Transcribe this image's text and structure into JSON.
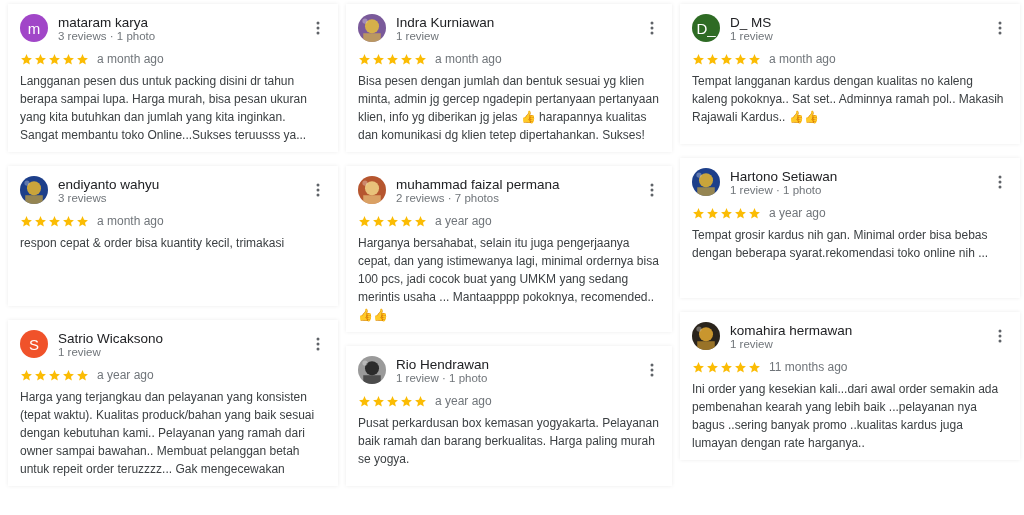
{
  "columns": [
    {
      "reviews": [
        {
          "avatar": {
            "kind": "letter",
            "letter": "m",
            "color": "#a146c8"
          },
          "name": "mataram karya",
          "meta": "3 reviews · 1 photo",
          "stars": 5,
          "time": "a month ago",
          "text": "Langganan pesen dus untuk packing disini dr tahun berapa sampai lupa. Harga murah, bisa pesan ukuran yang kita butuhkan dan jumlah yang kita inginkan. Sangat membantu toko Online...Sukses teruusss ya..."
        },
        {
          "name": "endiyanto wahyu",
          "meta": "3 reviews",
          "stars": 5,
          "time": "a month ago",
          "text": "respon cepat & order bisa kuantity kecil, trimakasi"
        },
        {
          "avatar": {
            "kind": "letter",
            "letter": "S",
            "color": "#f0522a"
          },
          "name": "Satrio Wicaksono",
          "meta": "1 review",
          "stars": 5,
          "time": "a year ago",
          "text": "Harga yang terjangkau dan pelayanan yang konsisten (tepat waktu). Kualitas produck/bahan yang baik sesuai dengan kebutuhan kami.. Pelayanan yang ramah dari owner sampai bawahan.. Membuat pelanggan betah untuk repeit order teruzzzz... Gak mengecewakan"
        }
      ]
    },
    {
      "reviews": [
        {
          "name": "Indra Kurniawan",
          "meta": "1 review",
          "stars": 5,
          "time": "a month ago",
          "text": "Bisa pesen dengan jumlah dan bentuk sesuai yg klien minta, admin jg gercep ngadepin pertanyaan pertanyaan klien, info yg diberikan jg jelas 👍 harapannya kualitas dan komunikasi dg klien tetep dipertahankan. Sukses!"
        },
        {
          "name": "muhammad faizal permana",
          "meta": "2 reviews · 7 photos",
          "stars": 5,
          "time": "a year ago",
          "text": "Harganya bersahabat, selain itu juga pengerjaanya cepat, dan yang istimewanya lagi, minimal ordernya bisa 100 pcs, jadi cocok buat yang UMKM yang sedang merintis usaha ... Mantaapppp pokoknya, recomended.. 👍👍"
        },
        {
          "name": "Rio Hendrawan",
          "meta": "1 review · 1 photo",
          "stars": 5,
          "time": "a year ago",
          "text": "Pusat perkardusan box kemasan yogyakarta. Pelayanan baik ramah dan barang berkualitas. Harga paling murah se yogya."
        }
      ]
    },
    {
      "reviews": [
        {
          "avatar": {
            "kind": "letter",
            "letter": "D_",
            "color": "#2e6b24"
          },
          "name": "D_ MS",
          "meta": "1 review",
          "stars": 5,
          "time": "a month ago",
          "text": "Tempat langganan kardus dengan kualitas no kaleng kaleng pokoknya.. Sat set.. Adminnya ramah pol.. Makasih Rajawali Kardus.. 👍👍"
        },
        {
          "name": "Hartono Setiawan",
          "meta": "1 review · 1 photo",
          "stars": 5,
          "time": "a year ago",
          "text": "Tempat grosir kardus nih gan. Minimal order bisa bebas dengan beberapa syarat.rekomendasi toko online nih ..."
        },
        {
          "name": "komahira hermawan",
          "meta": "1 review",
          "stars": 5,
          "time": "11 months ago",
          "text": "Ini order yang kesekian kali...dari awal order semakin ada pembenahan kearah yang lebih baik ...pelayanan nya bagus ..sering banyak promo ..kualitas kardus juga lumayan dengan rate harganya.."
        }
      ]
    }
  ]
}
